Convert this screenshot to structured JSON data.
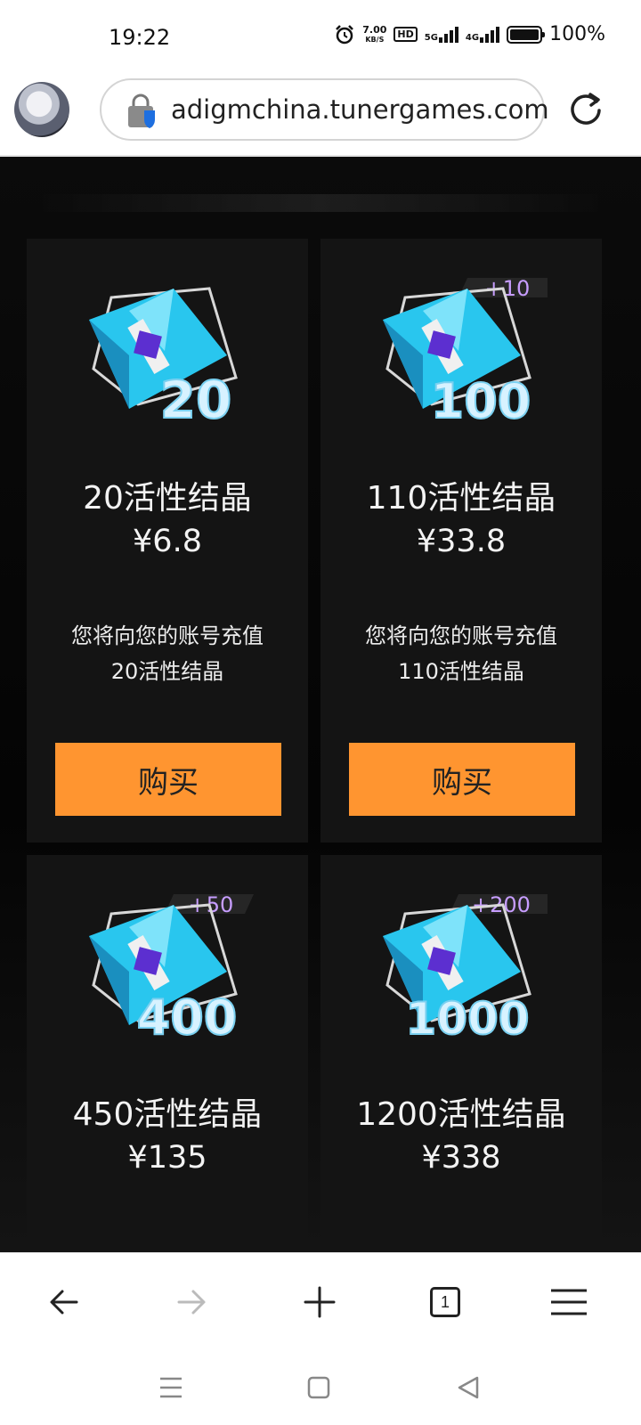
{
  "status_bar": {
    "time": "19:22",
    "net_speed_value": "7.00",
    "net_speed_unit": "KB/S",
    "hd_label": "HD",
    "signal1_label": "5G",
    "signal2_label": "4G",
    "battery": "100%"
  },
  "address_bar": {
    "url": "adigmchina.tunergames.com"
  },
  "products": [
    {
      "badge": "20",
      "bonus": "",
      "title": "20活性结晶",
      "price": "¥6.8",
      "desc_line1": "您将向您的账号充值",
      "desc_line2": "20活性结晶",
      "button": "购买"
    },
    {
      "badge": "100",
      "bonus": "+10",
      "title": "110活性结晶",
      "price": "¥33.8",
      "desc_line1": "您将向您的账号充值",
      "desc_line2": "110活性结晶",
      "button": "购买"
    },
    {
      "badge": "400",
      "bonus": "+50",
      "title": "450活性结晶",
      "price": "¥135"
    },
    {
      "badge": "1000",
      "bonus": "+200",
      "title": "1200活性结晶",
      "price": "¥338"
    }
  ],
  "toolbar": {
    "tab_count": "1"
  },
  "colors": {
    "accent": "#ff9530",
    "card_bg": "#141414",
    "crystal": "#29c6ee"
  }
}
